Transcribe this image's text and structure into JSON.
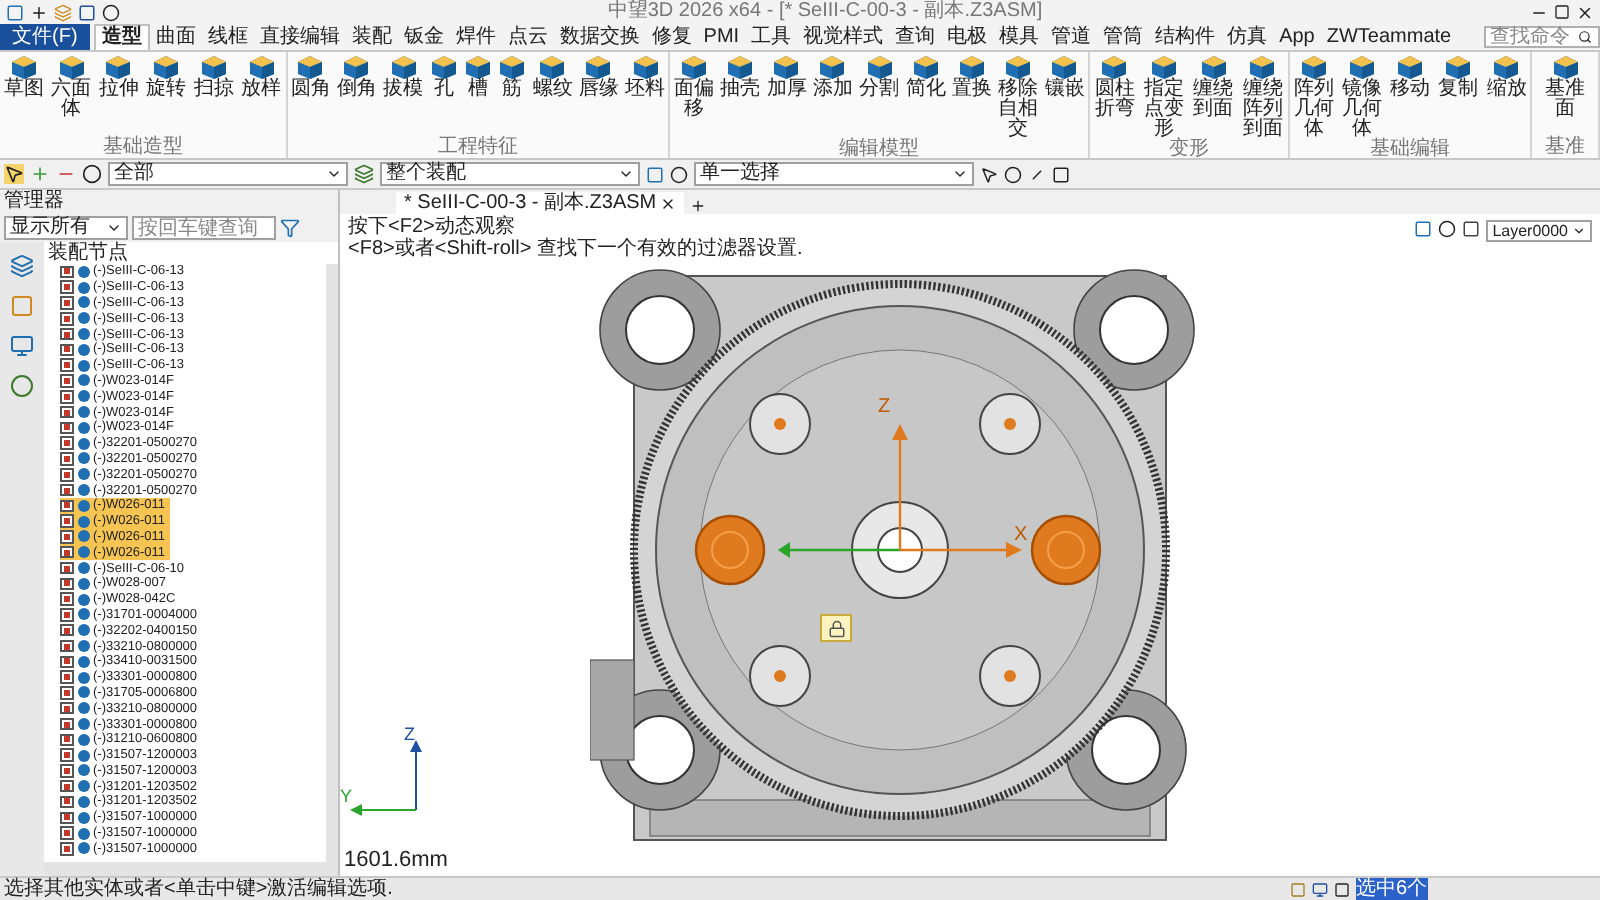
{
  "window": {
    "title": "中望3D 2026 x64 - [* SeIII-C-00-3 - 副本.Z3ASM]"
  },
  "menu_tabs": [
    {
      "label": "文件(F)",
      "kind": "file",
      "selected": false
    },
    {
      "label": "造型",
      "kind": "tab",
      "selected": true
    },
    {
      "label": "曲面",
      "kind": "tab",
      "selected": false
    },
    {
      "label": "线框",
      "kind": "tab",
      "selected": false
    },
    {
      "label": "直接编辑",
      "kind": "tab",
      "selected": false
    },
    {
      "label": "装配",
      "kind": "tab",
      "selected": false
    },
    {
      "label": "钣金",
      "kind": "tab",
      "selected": false
    },
    {
      "label": "焊件",
      "kind": "tab",
      "selected": false
    },
    {
      "label": "点云",
      "kind": "tab",
      "selected": false
    },
    {
      "label": "数据交换",
      "kind": "tab",
      "selected": false
    },
    {
      "label": "修复",
      "kind": "tab",
      "selected": false
    },
    {
      "label": "PMI",
      "kind": "tab",
      "selected": false
    },
    {
      "label": "工具",
      "kind": "tab",
      "selected": false
    },
    {
      "label": "视觉样式",
      "kind": "tab",
      "selected": false
    },
    {
      "label": "查询",
      "kind": "tab",
      "selected": false
    },
    {
      "label": "电极",
      "kind": "tab",
      "selected": false
    },
    {
      "label": "模具",
      "kind": "tab",
      "selected": false
    },
    {
      "label": "管道",
      "kind": "tab",
      "selected": false
    },
    {
      "label": "管筒",
      "kind": "tab",
      "selected": false
    },
    {
      "label": "结构件",
      "kind": "tab",
      "selected": false
    },
    {
      "label": "仿真",
      "kind": "tab",
      "selected": false
    },
    {
      "label": "App",
      "kind": "tab",
      "selected": false
    },
    {
      "label": "ZWTeammate",
      "kind": "tab",
      "selected": false
    }
  ],
  "search": {
    "placeholder": "查找命令"
  },
  "ribbon_groups": [
    {
      "label": "基础造型",
      "buttons": [
        "草图",
        "六面体",
        "拉伸",
        "旋转",
        "扫掠",
        "放样"
      ]
    },
    {
      "label": "工程特征",
      "buttons": [
        "圆角",
        "倒角",
        "拔模",
        "孔",
        "槽",
        "筋",
        "螺纹",
        "唇缘",
        "坯料"
      ]
    },
    {
      "label": "编辑模型",
      "buttons": [
        "面偏移",
        "抽壳",
        "加厚",
        "添加",
        "分割",
        "简化",
        "置换",
        "移除自相交",
        "镶嵌"
      ]
    },
    {
      "label": "变形",
      "buttons": [
        "圆柱折弯",
        "指定点变形",
        "缠绕到面",
        "缠绕阵列到面"
      ]
    },
    {
      "label": "基础编辑",
      "buttons": [
        "阵列几何体",
        "镜像几何体",
        "移动",
        "复制",
        "缩放"
      ]
    },
    {
      "label": "基准",
      "buttons": [
        "基准面"
      ]
    }
  ],
  "toolbar": {
    "filter": "全部",
    "scope": "整个装配",
    "selection": "单一选择"
  },
  "manager": {
    "title": "管理器",
    "filter": "显示所有",
    "search_placeholder": "按回车键查询",
    "tree_header": "装配节点",
    "items": [
      {
        "label": "(-)SeIII-C-06-13",
        "checked": true,
        "selected": false
      },
      {
        "label": "(-)SeIII-C-06-13",
        "checked": true,
        "selected": false
      },
      {
        "label": "(-)SeIII-C-06-13",
        "checked": true,
        "selected": false
      },
      {
        "label": "(-)SeIII-C-06-13",
        "checked": true,
        "selected": false
      },
      {
        "label": "(-)SeIII-C-06-13",
        "checked": true,
        "selected": false
      },
      {
        "label": "(-)SeIII-C-06-13",
        "checked": true,
        "selected": false
      },
      {
        "label": "(-)SeIII-C-06-13",
        "checked": true,
        "selected": false
      },
      {
        "label": "(-)W023-014F",
        "checked": true,
        "selected": false
      },
      {
        "label": "(-)W023-014F",
        "checked": true,
        "selected": false
      },
      {
        "label": "(-)W023-014F",
        "checked": true,
        "selected": false
      },
      {
        "label": "(-)W023-014F",
        "checked": true,
        "selected": false
      },
      {
        "label": "(-)32201-0500270",
        "checked": true,
        "selected": false
      },
      {
        "label": "(-)32201-0500270",
        "checked": true,
        "selected": false
      },
      {
        "label": "(-)32201-0500270",
        "checked": true,
        "selected": false
      },
      {
        "label": "(-)32201-0500270",
        "checked": true,
        "selected": false
      },
      {
        "label": "(-)W026-011",
        "checked": true,
        "selected": true
      },
      {
        "label": "(-)W026-011",
        "checked": true,
        "selected": true
      },
      {
        "label": "(-)W026-011",
        "checked": true,
        "selected": true
      },
      {
        "label": "(-)W026-011",
        "checked": true,
        "selected": true
      },
      {
        "label": "(-)SeIII-C-06-10",
        "checked": true,
        "selected": false
      },
      {
        "label": "(-)W028-007",
        "checked": true,
        "selected": false
      },
      {
        "label": "(-)W028-042C",
        "checked": true,
        "selected": false
      },
      {
        "label": "(-)31701-0004000",
        "checked": true,
        "selected": false
      },
      {
        "label": "(-)32202-0400150",
        "checked": true,
        "selected": false
      },
      {
        "label": "(-)33210-0800000",
        "checked": true,
        "selected": false
      },
      {
        "label": "(-)33410-0031500",
        "checked": true,
        "selected": false
      },
      {
        "label": "(-)33301-0000800",
        "checked": true,
        "selected": false
      },
      {
        "label": "(-)31705-0006800",
        "checked": true,
        "selected": false
      },
      {
        "label": "(-)33210-0800000",
        "checked": true,
        "selected": false
      },
      {
        "label": "(-)33301-0000800",
        "checked": true,
        "selected": false
      },
      {
        "label": "(-)31210-0600800",
        "checked": true,
        "selected": false
      },
      {
        "label": "(-)31507-1200003",
        "checked": true,
        "selected": false
      },
      {
        "label": "(-)31507-1200003",
        "checked": true,
        "selected": false
      },
      {
        "label": "(-)31201-1203502",
        "checked": true,
        "selected": false
      },
      {
        "label": "(-)31201-1203502",
        "checked": true,
        "selected": false
      },
      {
        "label": "(-)31507-1000000",
        "checked": true,
        "selected": false
      },
      {
        "label": "(-)31507-1000000",
        "checked": true,
        "selected": false
      },
      {
        "label": "(-)31507-1000000",
        "checked": true,
        "selected": false
      }
    ]
  },
  "document_tab": {
    "label": "* SeIII-C-00-3 - 副本.Z3ASM"
  },
  "hints": [
    "按下<F2>动态观察",
    "<F8>或者<Shift-roll> 查找下一个有效的过滤器设置."
  ],
  "layer": "Layer0000",
  "triad_labels": {
    "center_z": "Z",
    "center_x": "X",
    "corner_z": "Z",
    "corner_y": "Y"
  },
  "scale_text": "1601.6mm",
  "status_bar": {
    "message": "选择其他实体或者<单击中键>激活编辑选项.",
    "selection": "选中6个"
  }
}
